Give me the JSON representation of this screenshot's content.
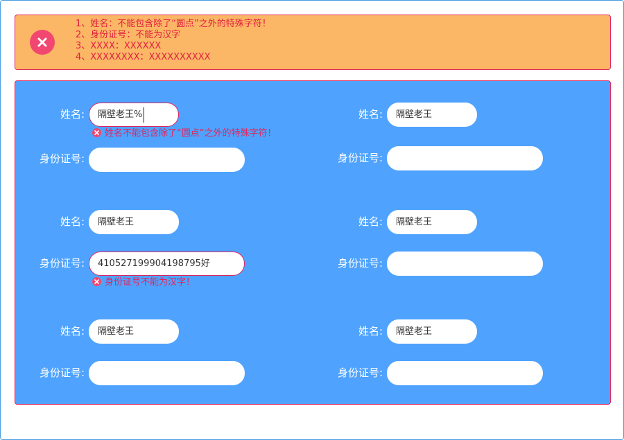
{
  "alert": {
    "icon": "error-circle-icon",
    "messages": [
      "1、姓名：不能包含除了“圆点”之外的特殊字符！",
      "2、身份证号：不能为汉字",
      "3、XXXX：XXXXXX",
      "4、XXXXXXXX：XXXXXXXXXX"
    ]
  },
  "form": {
    "name_label": "姓名:",
    "id_label": "身份证号:",
    "entries": [
      {
        "name": "隔壁老王%",
        "id": "",
        "name_error": "姓名不能包含除了“圆点”之外的特殊字符！"
      },
      {
        "name": "隔壁老王",
        "id": ""
      },
      {
        "name": "隔壁老王",
        "id": "410527199904198795好",
        "id_error": "身份证号不能为汉字！"
      },
      {
        "name": "隔壁老王",
        "id": ""
      },
      {
        "name": "隔壁老王",
        "id": ""
      },
      {
        "name": "隔壁老王",
        "id": ""
      }
    ]
  },
  "colors": {
    "alert_bg": "#fbb666",
    "panel_bg": "#4fa3fe",
    "error": "#e0245e",
    "error_icon": "#f14770"
  }
}
